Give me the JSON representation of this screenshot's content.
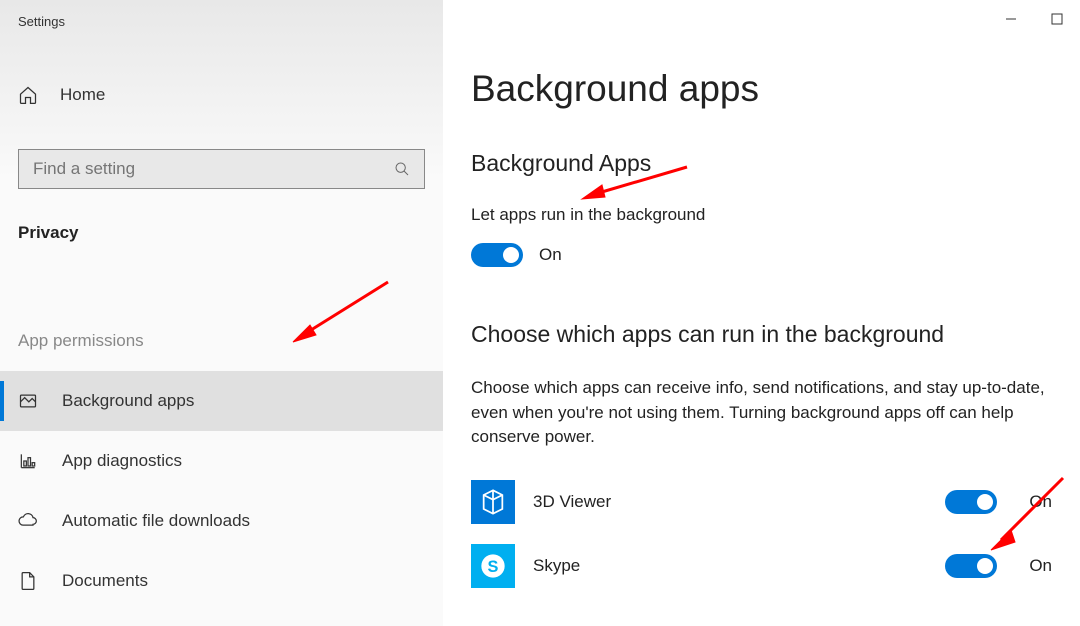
{
  "window": {
    "title": "Settings"
  },
  "sidebar": {
    "home": "Home",
    "search_placeholder": "Find a setting",
    "section": "Privacy",
    "subsection": "App permissions",
    "items": [
      {
        "label": "Background apps",
        "active": true
      },
      {
        "label": "App diagnostics",
        "active": false
      },
      {
        "label": "Automatic file downloads",
        "active": false
      },
      {
        "label": "Documents",
        "active": false
      }
    ]
  },
  "page": {
    "title": "Background apps",
    "section1_title": "Background Apps",
    "setting1_label": "Let apps run in the background",
    "setting1_state": "On",
    "section2_title": "Choose which apps can run in the background",
    "section2_desc": "Choose which apps can receive info, send notifications, and stay up-to-date, even when you're not using them. Turning background apps off can help conserve power.",
    "apps": [
      {
        "name": "3D Viewer",
        "state": "On"
      },
      {
        "name": "Skype",
        "state": "On"
      }
    ]
  },
  "colors": {
    "accent": "#0078d7",
    "annotation": "#ff0000"
  }
}
